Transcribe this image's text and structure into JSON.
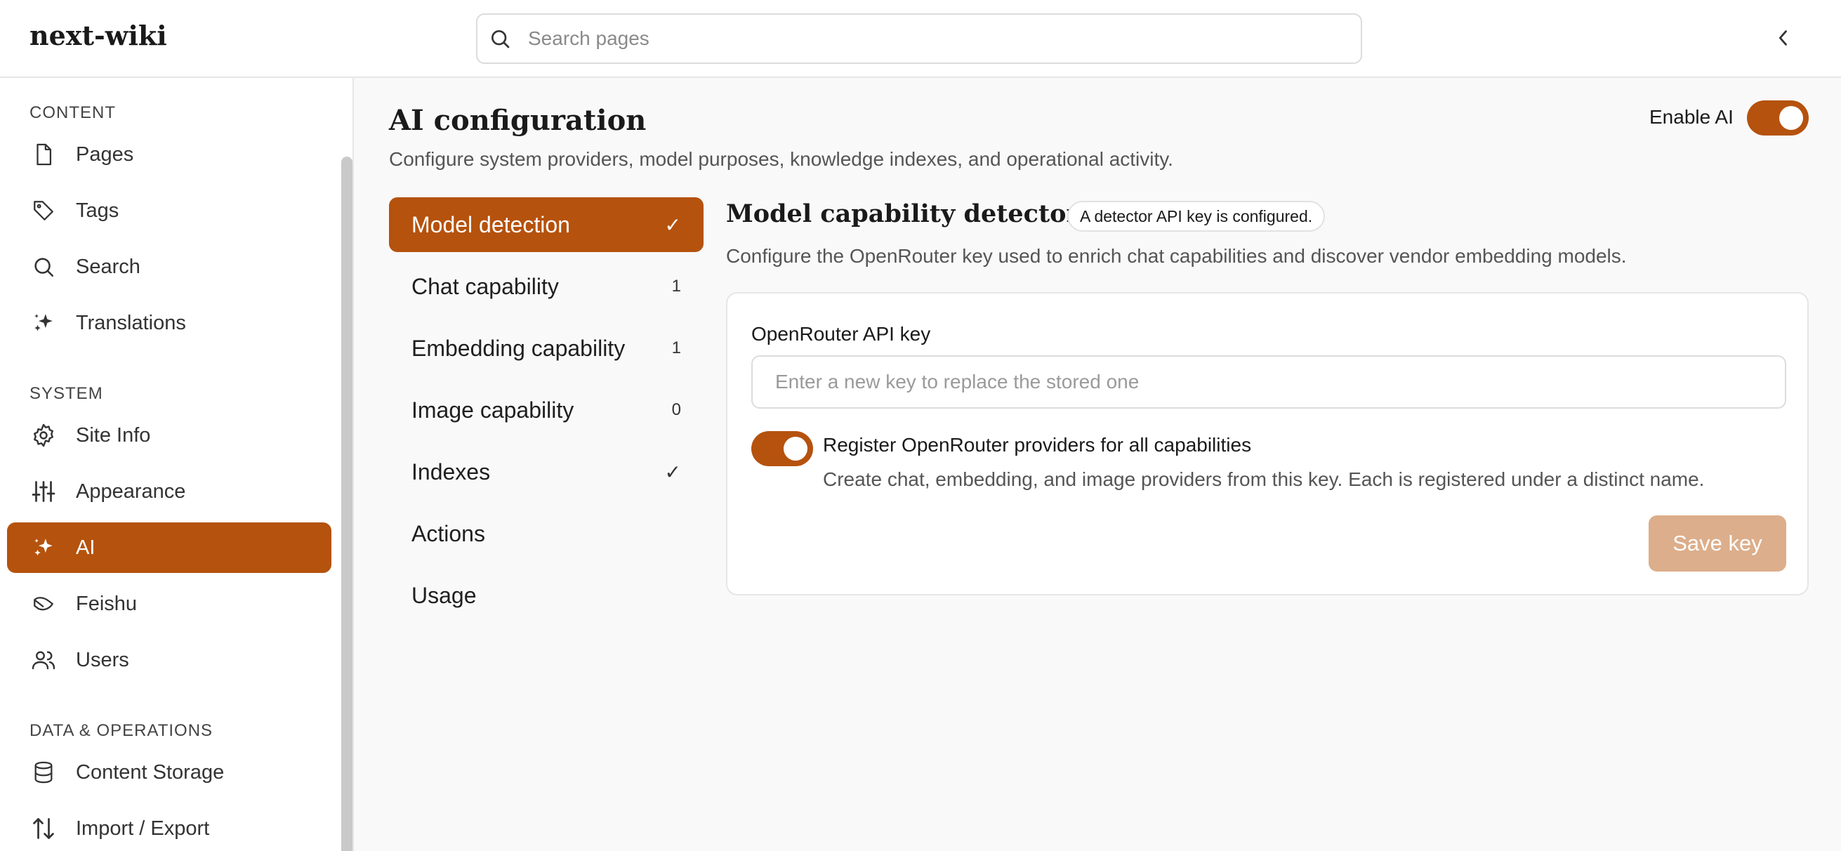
{
  "app": {
    "brand": "next-wiki"
  },
  "search": {
    "placeholder": "Search pages"
  },
  "sidebar": {
    "sections": [
      {
        "label": "CONTENT"
      },
      {
        "label": "SYSTEM"
      },
      {
        "label": "DATA & OPERATIONS"
      }
    ],
    "items": [
      {
        "label": "Pages",
        "icon": "file-icon"
      },
      {
        "label": "Tags",
        "icon": "tag-icon"
      },
      {
        "label": "Search",
        "icon": "search-icon"
      },
      {
        "label": "Translations",
        "icon": "sparkles-icon"
      },
      {
        "label": "Site Info",
        "icon": "gear-icon"
      },
      {
        "label": "Appearance",
        "icon": "sliders-icon"
      },
      {
        "label": "AI",
        "icon": "sparkles-icon",
        "active": true
      },
      {
        "label": "Feishu",
        "icon": "feishu-icon"
      },
      {
        "label": "Users",
        "icon": "users-icon"
      },
      {
        "label": "Content Storage",
        "icon": "database-icon"
      },
      {
        "label": "Import / Export",
        "icon": "arrows-updown-icon"
      }
    ]
  },
  "main": {
    "title": "AI configuration",
    "subtitle": "Configure system providers, model purposes, knowledge indexes, and operational activity.",
    "enable_ai": {
      "label": "Enable AI",
      "on": true
    }
  },
  "subnav": {
    "items": [
      {
        "label": "Model detection",
        "indicator": "✓",
        "active": true
      },
      {
        "label": "Chat capability",
        "indicator": "1"
      },
      {
        "label": "Embedding capability",
        "indicator": "1"
      },
      {
        "label": "Image capability",
        "indicator": "0"
      },
      {
        "label": "Indexes",
        "indicator": "✓"
      },
      {
        "label": "Actions",
        "indicator": ""
      },
      {
        "label": "Usage",
        "indicator": ""
      }
    ]
  },
  "panel": {
    "title": "Model capability detector",
    "badge": "A detector API key is configured.",
    "subtitle": "Configure the OpenRouter key used to enrich chat capabilities and discover vendor embedding models.",
    "api_key": {
      "label": "OpenRouter API key",
      "placeholder": "Enter a new key to replace the stored one",
      "value": ""
    },
    "register": {
      "title": "Register OpenRouter providers for all capabilities",
      "description": "Create chat, embedding, and image providers from this key. Each is registered under a distinct name.",
      "on": true
    },
    "save_label": "Save key"
  },
  "colors": {
    "accent": "#b5520d",
    "accent_disabled": "#dcae8b"
  }
}
